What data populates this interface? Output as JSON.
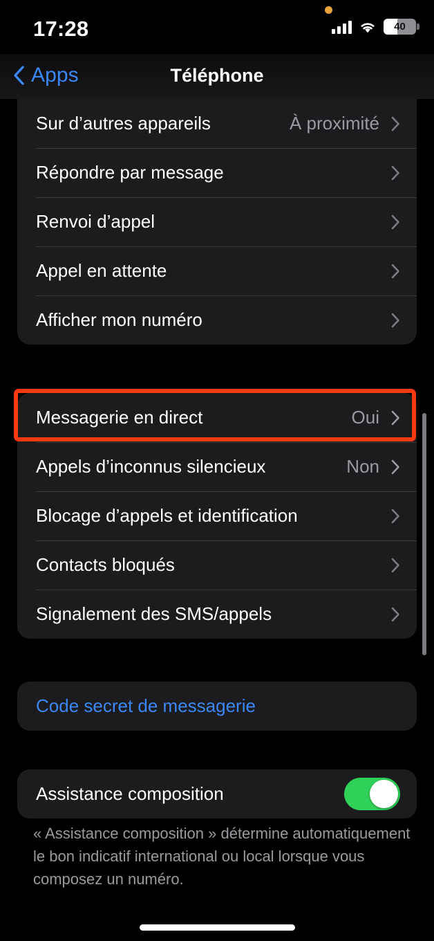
{
  "status_bar": {
    "time": "17:28",
    "battery_percent": "40",
    "battery_level_fraction": 0.4,
    "cellular_icon": "cellular-bars-icon",
    "wifi_icon": "wifi-icon",
    "mic_indicator_icon": "orange-recording-dot-icon",
    "mic_indicator_color": "#e8a33d"
  },
  "nav": {
    "back_label": "Apps",
    "back_icon": "chevron-left-icon",
    "title": "Téléphone",
    "accent_color": "#3b87f5"
  },
  "groups": [
    {
      "id": "call-settings",
      "rows": [
        {
          "label": "Sur d’autres appareils",
          "value": "À proximité",
          "accessory": "chevron-right-icon"
        },
        {
          "label": "Répondre par message",
          "value": "",
          "accessory": "chevron-right-icon"
        },
        {
          "label": "Renvoi d’appel",
          "value": "",
          "accessory": "chevron-right-icon"
        },
        {
          "label": "Appel en attente",
          "value": "",
          "accessory": "chevron-right-icon"
        },
        {
          "label": "Afficher mon numéro",
          "value": "",
          "accessory": "chevron-right-icon"
        }
      ]
    },
    {
      "id": "voicemail-blocking",
      "rows": [
        {
          "label": "Messagerie en direct",
          "value": "Oui",
          "accessory": "chevron-right-icon",
          "highlighted": true
        },
        {
          "label": "Appels d’inconnus silencieux",
          "value": "Non",
          "accessory": "chevron-right-icon"
        },
        {
          "label": "Blocage d’appels et identification",
          "value": "",
          "accessory": "chevron-right-icon"
        },
        {
          "label": "Contacts bloqués",
          "value": "",
          "accessory": "chevron-right-icon"
        },
        {
          "label": "Signalement des SMS/appels",
          "value": "",
          "accessory": "chevron-right-icon"
        }
      ]
    },
    {
      "id": "voicemail-password",
      "rows": [
        {
          "label": "Code secret de messagerie",
          "value": "",
          "accessory": "none",
          "style": "link"
        }
      ]
    },
    {
      "id": "dial-assist",
      "rows": [
        {
          "label": "Assistance composition",
          "value": "",
          "accessory": "toggle",
          "toggle_on": true
        }
      ]
    }
  ],
  "footer": {
    "note": "« Assistance composition » détermine automatiquement le bon indicatif international ou local lorsque vous composez un numéro."
  },
  "highlight": {
    "color": "#f93a11",
    "target_row": "Messagerie en direct"
  },
  "scrollbar": {
    "visible": true
  },
  "home_indicator": {
    "visible": true
  }
}
